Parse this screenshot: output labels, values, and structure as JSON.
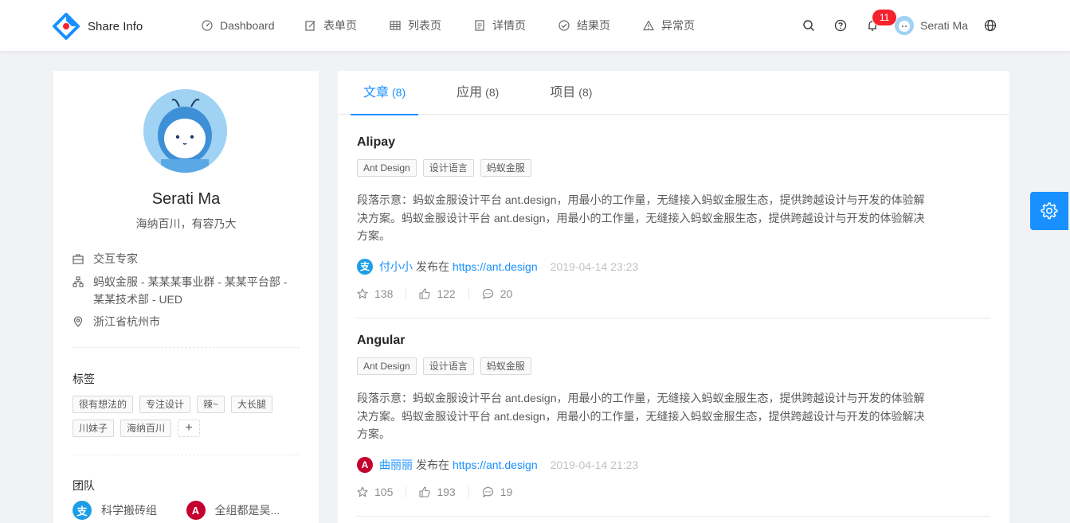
{
  "header": {
    "logo_title": "Share Info",
    "nav": [
      {
        "label": "Dashboard",
        "icon": "dashboard-icon"
      },
      {
        "label": "表单页",
        "icon": "form-icon"
      },
      {
        "label": "列表页",
        "icon": "table-icon"
      },
      {
        "label": "详情页",
        "icon": "profile-icon"
      },
      {
        "label": "结果页",
        "icon": "check-circle-icon"
      },
      {
        "label": "异常页",
        "icon": "warning-icon"
      }
    ],
    "notification_count": "11",
    "user_name": "Serati Ma"
  },
  "profile": {
    "name": "Serati Ma",
    "signature": "海纳百川，有容乃大",
    "title": "交互专家",
    "group": "蚂蚁金服 - 某某某事业群 - 某某平台部 - 某某技术部 - UED",
    "location": "浙江省杭州市",
    "tags_title": "标签",
    "tags": [
      "很有想法的",
      "专注设计",
      "辣~",
      "大长腿",
      "川妹子",
      "海纳百川"
    ],
    "team_title": "团队",
    "team": [
      {
        "name": "科学搬砖组",
        "color": "#1c9ee6",
        "glyph": "支"
      },
      {
        "name": "全组都是吴...",
        "color": "#c3002f",
        "glyph": "A"
      }
    ]
  },
  "tabs": [
    {
      "label": "文章",
      "count": "(8)"
    },
    {
      "label": "应用",
      "count": "(8)"
    },
    {
      "label": "项目",
      "count": "(8)"
    }
  ],
  "articles": [
    {
      "title": "Alipay",
      "tags": [
        "Ant Design",
        "设计语言",
        "蚂蚁金服"
      ],
      "description": "段落示意：蚂蚁金服设计平台 ant.design，用最小的工作量，无缝接入蚂蚁金服生态，提供跨越设计与开发的体验解决方案。蚂蚁金服设计平台 ant.design，用最小的工作量，无缝接入蚂蚁金服生态，提供跨越设计与开发的体验解决方案。",
      "owner": "付小小",
      "owner_color": "#1c9ee6",
      "owner_glyph": "支",
      "published_text": "发布在",
      "href": "https://ant.design",
      "time": "2019-04-14 23:23",
      "stars": "138",
      "likes": "122",
      "comments": "20"
    },
    {
      "title": "Angular",
      "tags": [
        "Ant Design",
        "设计语言",
        "蚂蚁金服"
      ],
      "description": "段落示意：蚂蚁金服设计平台 ant.design，用最小的工作量，无缝接入蚂蚁金服生态，提供跨越设计与开发的体验解决方案。蚂蚁金服设计平台 ant.design，用最小的工作量，无缝接入蚂蚁金服生态，提供跨越设计与开发的体验解决方案。",
      "owner": "曲丽丽",
      "owner_color": "#c3002f",
      "owner_glyph": "A",
      "published_text": "发布在",
      "href": "https://ant.design",
      "time": "2019-04-14 21:23",
      "stars": "105",
      "likes": "193",
      "comments": "19"
    }
  ],
  "colors": {
    "primary": "#1890ff",
    "badge": "#f5222d"
  }
}
